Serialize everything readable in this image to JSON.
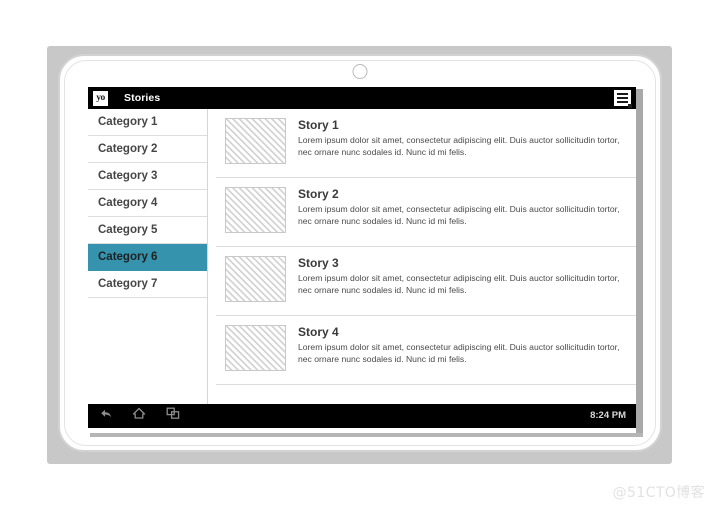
{
  "device": {
    "camera_icon": "camera-circle",
    "frame_color": "#d2d2d2",
    "plate_color": "#c8c8c8"
  },
  "app": {
    "icon_text": "yo",
    "icon_name": "app-logo-icon",
    "title": "Stories",
    "menu_icon": "hamburger-menu-icon",
    "titlebar_color": "#000000"
  },
  "sidebar": {
    "selected_index": 5,
    "selected_color": "#3593ad",
    "items": [
      {
        "label": "Category 1"
      },
      {
        "label": "Category 2"
      },
      {
        "label": "Category 3"
      },
      {
        "label": "Category 4"
      },
      {
        "label": "Category 5"
      },
      {
        "label": "Category 6"
      },
      {
        "label": "Category 7"
      }
    ]
  },
  "stories": [
    {
      "title": "Story 1",
      "description": "Lorem ipsum dolor sit amet, consectetur adipiscing elit. Duis auctor sollicitudin tortor, nec ornare nunc sodales id. Nunc id mi felis.",
      "thumbnail": "placeholder-hatched-image"
    },
    {
      "title": "Story 2",
      "description": "Lorem ipsum dolor sit amet, consectetur adipiscing elit. Duis auctor sollicitudin tortor, nec ornare nunc sodales id. Nunc id mi felis.",
      "thumbnail": "placeholder-hatched-image"
    },
    {
      "title": "Story 3",
      "description": "Lorem ipsum dolor sit amet, consectetur adipiscing elit. Duis auctor sollicitudin tortor, nec ornare nunc sodales id. Nunc id mi felis.",
      "thumbnail": "placeholder-hatched-image"
    },
    {
      "title": "Story 4",
      "description": "Lorem ipsum dolor sit amet, consectetur adipiscing elit. Duis auctor sollicitudin tortor, nec ornare nunc sodales id. Nunc id mi felis.",
      "thumbnail": "placeholder-hatched-image"
    }
  ],
  "navbar": {
    "back_icon": "back-arrow-icon",
    "home_icon": "home-icon",
    "recents_icon": "recent-apps-icon",
    "time": "8:24 PM"
  },
  "watermark": {
    "text": "@51CTO博客"
  }
}
